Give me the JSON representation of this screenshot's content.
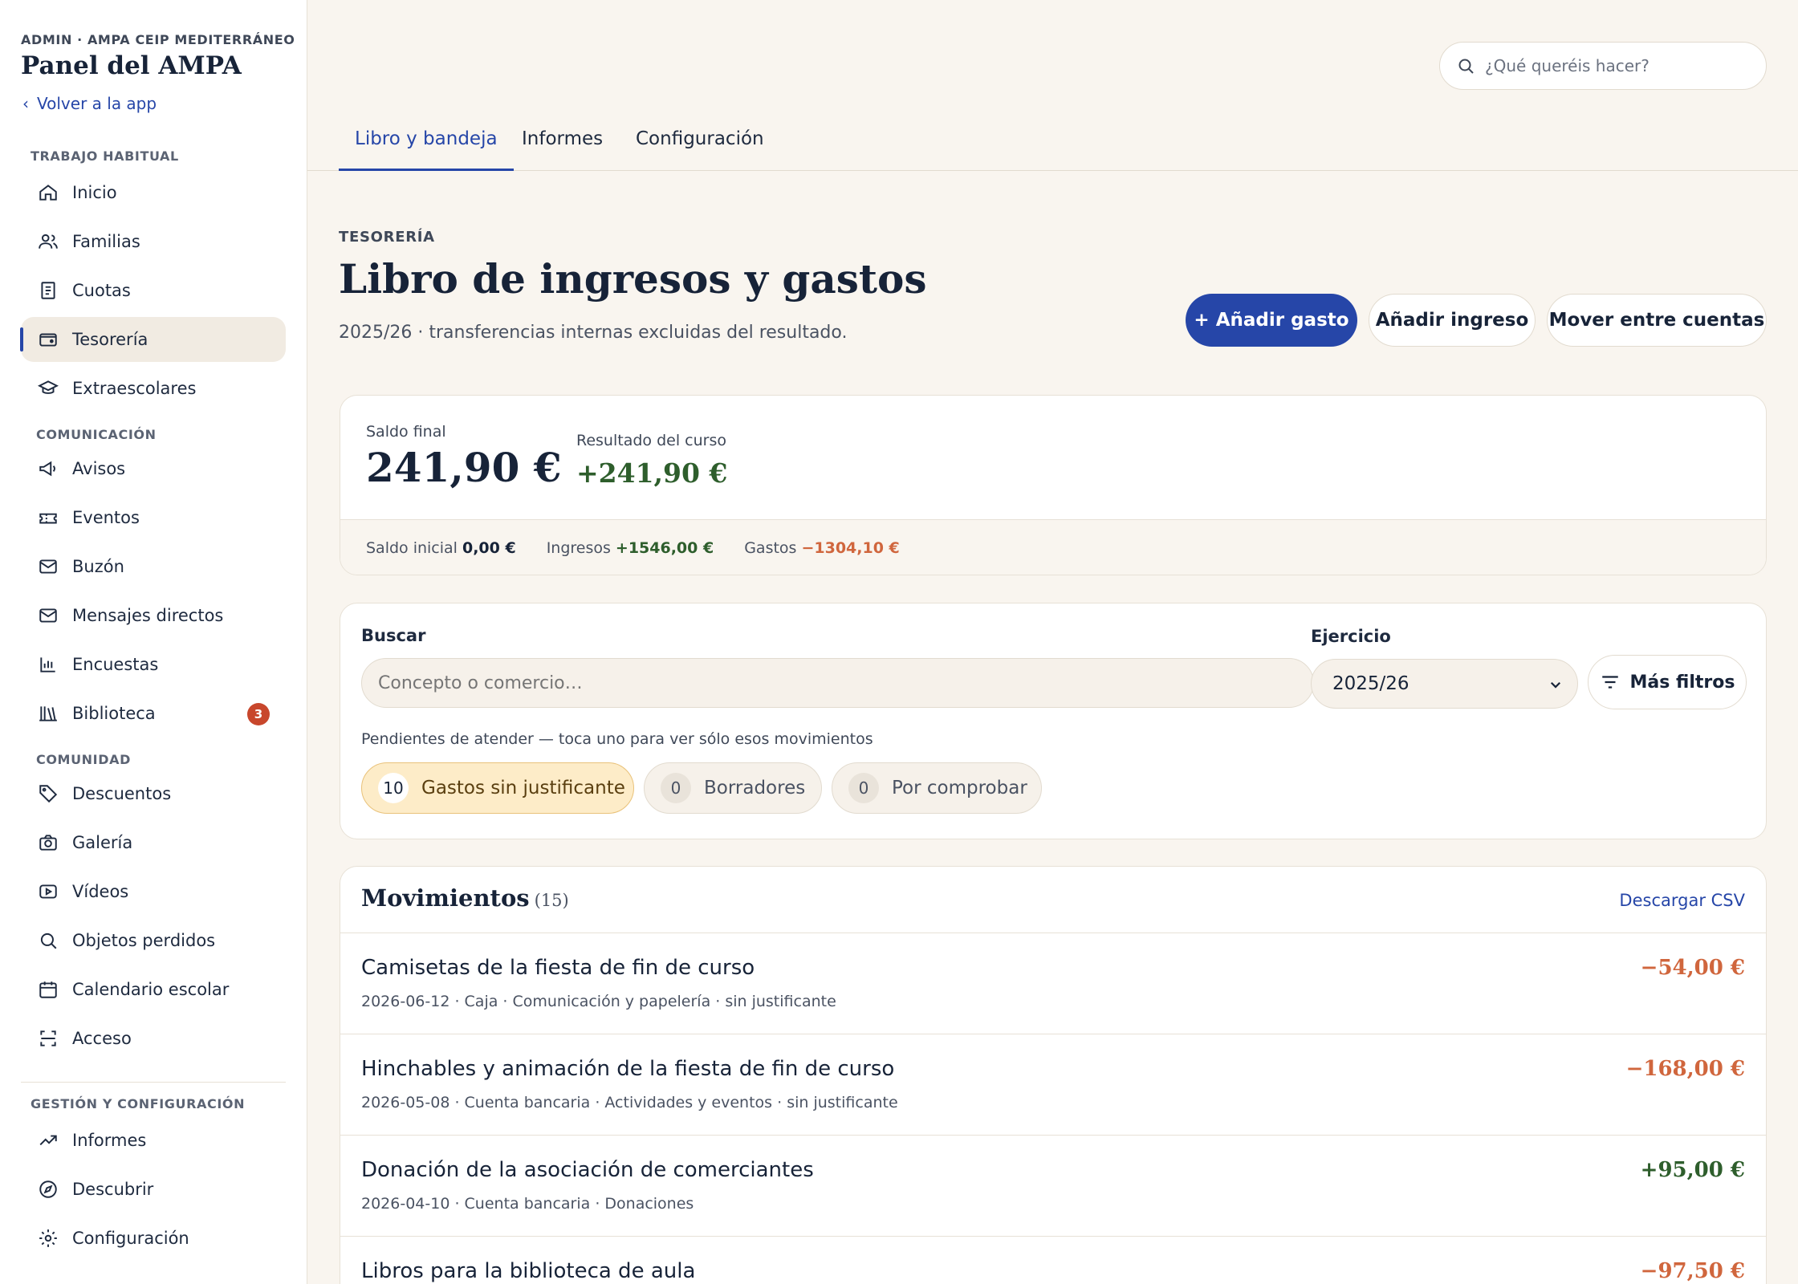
{
  "sidebar": {
    "org": "ADMIN · AMPA CEIP MEDITERRÁNEO",
    "title": "Panel del AMPA",
    "back": "Volver a la app",
    "sections": {
      "habitual": "TRABAJO HABITUAL",
      "comunicacion": "COMUNICACIÓN",
      "comunidad": "COMUNIDAD",
      "gestion": "GESTIÓN Y CONFIGURACIÓN"
    },
    "items": [
      {
        "label": "Inicio",
        "icon": "home-icon"
      },
      {
        "label": "Familias",
        "icon": "users-icon"
      },
      {
        "label": "Cuotas",
        "icon": "receipt-icon"
      },
      {
        "label": "Tesorería",
        "icon": "wallet-icon",
        "active": true
      },
      {
        "label": "Extraescolares",
        "icon": "graduation-cap-icon"
      },
      {
        "label": "Avisos",
        "icon": "megaphone-icon"
      },
      {
        "label": "Eventos",
        "icon": "ticket-icon"
      },
      {
        "label": "Buzón",
        "icon": "mail-icon"
      },
      {
        "label": "Mensajes directos",
        "icon": "mail-icon"
      },
      {
        "label": "Encuestas",
        "icon": "bar-chart-icon"
      },
      {
        "label": "Biblioteca",
        "icon": "library-icon",
        "badge": "3"
      },
      {
        "label": "Descuentos",
        "icon": "tag-icon"
      },
      {
        "label": "Galería",
        "icon": "camera-icon"
      },
      {
        "label": "Vídeos",
        "icon": "video-icon"
      },
      {
        "label": "Objetos perdidos",
        "icon": "search-icon"
      },
      {
        "label": "Calendario escolar",
        "icon": "calendar-icon"
      },
      {
        "label": "Acceso",
        "icon": "scan-icon"
      },
      {
        "label": "Informes",
        "icon": "trend-icon"
      },
      {
        "label": "Descubrir",
        "icon": "compass-icon"
      },
      {
        "label": "Configuración",
        "icon": "gear-icon"
      }
    ]
  },
  "header": {
    "search_placeholder": "¿Qué queréis hacer?",
    "tabs": [
      "Libro y bandeja",
      "Informes",
      "Configuración"
    ]
  },
  "page": {
    "eyebrow": "TESORERÍA",
    "title": "Libro de ingresos y gastos",
    "subtitle": "2025/26 · transferencias internas excluidas del resultado.",
    "actions": {
      "add_expense": "+ Añadir gasto",
      "add_income": "Añadir ingreso",
      "move": "Mover entre cuentas"
    }
  },
  "summary": {
    "saldo_final_label": "Saldo final",
    "saldo_final": "241,90 €",
    "resultado_label": "Resultado del curso",
    "resultado": "+241,90 €",
    "saldo_inicial_label": "Saldo inicial",
    "saldo_inicial": "0,00 €",
    "ingresos_label": "Ingresos",
    "ingresos": "+1546,00 €",
    "gastos_label": "Gastos",
    "gastos": "−1304,10 €"
  },
  "filters": {
    "buscar_label": "Buscar",
    "buscar_placeholder": "Concepto o comercio…",
    "ejercicio_label": "Ejercicio",
    "ejercicio_value": "2025/26",
    "more_filters": "Más filtros",
    "pending_hint": "Pendientes de atender — toca uno para ver sólo esos movimientos",
    "chips": [
      {
        "count": "10",
        "label": "Gastos sin justificante"
      },
      {
        "count": "0",
        "label": "Borradores"
      },
      {
        "count": "0",
        "label": "Por comprobar"
      }
    ]
  },
  "movimientos": {
    "title": "Movimientos",
    "count": "(15)",
    "download": "Descargar CSV",
    "rows": [
      {
        "title": "Camisetas de la fiesta de fin de curso",
        "meta": "2026-06-12 · Caja · Comunicación y papelería · sin justificante",
        "amount": "−54,00 €",
        "sign": "neg"
      },
      {
        "title": "Hinchables y animación de la fiesta de fin de curso",
        "meta": "2026-05-08 · Cuenta bancaria · Actividades y eventos · sin justificante",
        "amount": "−168,00 €",
        "sign": "neg"
      },
      {
        "title": "Donación de la asociación de comerciantes",
        "meta": "2026-04-10 · Cuenta bancaria · Donaciones",
        "amount": "+95,00 €",
        "sign": "pos"
      },
      {
        "title": "Libros para la biblioteca de aula",
        "meta": "",
        "amount": "−97,50 €",
        "sign": "neg"
      }
    ]
  },
  "colors": {
    "accent": "#2646a8",
    "positive": "#2e5e2c",
    "negative": "#d0663d",
    "badge": "#c8472c"
  }
}
